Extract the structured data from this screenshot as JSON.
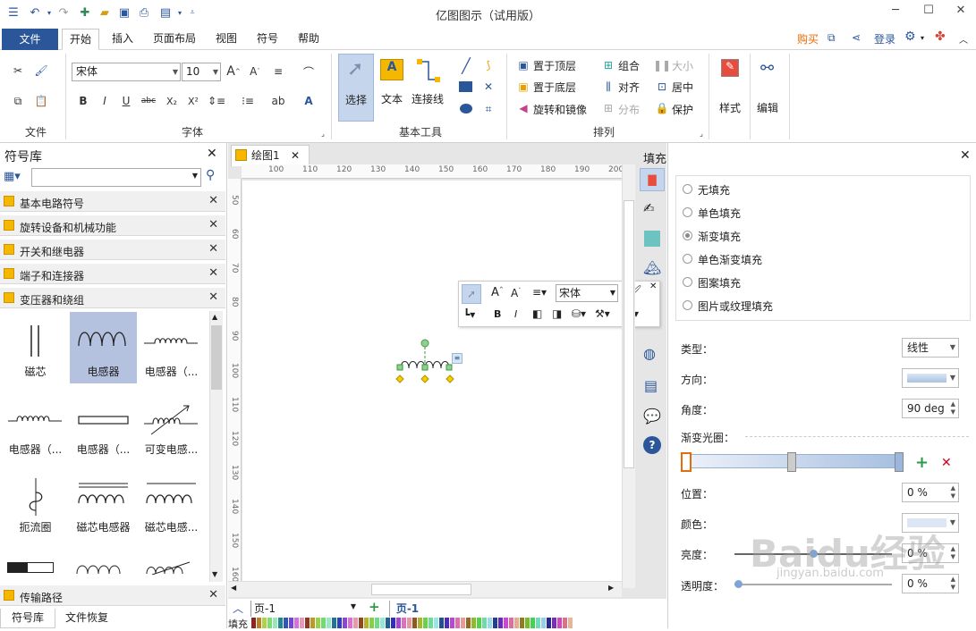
{
  "app_title": "亿图图示（试用版）",
  "menu": {
    "file": "文件",
    "tabs": [
      "开始",
      "插入",
      "页面布局",
      "视图",
      "符号",
      "帮助"
    ],
    "buy": "购买",
    "login": "登录"
  },
  "ribbon": {
    "group_file": "文件",
    "font_name": "宋体",
    "font_size": "10",
    "group_font": "字体",
    "select": "选择",
    "text": "文本",
    "connector": "连接线",
    "group_basic_tools": "基本工具",
    "bring_front": "置于顶层",
    "send_back": "置于底层",
    "rotate_mirror": "旋转和镜像",
    "group": "组合",
    "align": "对齐",
    "distribute": "分布",
    "size": "大小",
    "center": "居中",
    "protect": "保护",
    "group_arrange": "排列",
    "style": "样式",
    "edit": "编辑"
  },
  "library": {
    "title": "符号库",
    "search_placeholder": "",
    "categories": [
      "基本电路符号",
      "旋转设备和机械功能",
      "开关和继电器",
      "端子和连接器",
      "变压器和绕组"
    ],
    "shapes": [
      "磁芯",
      "电感器",
      "电感器（...",
      "电感器（...",
      "电感器（...",
      "可变电感...",
      "扼流圈",
      "磁芯电感器",
      "磁芯电感..."
    ],
    "bottom_category": "传输路径",
    "bottom_tabs": [
      "符号库",
      "文件恢复"
    ]
  },
  "canvas": {
    "doc_tab": "绘图1",
    "hruler_ticks": [
      "100",
      "110",
      "120",
      "130",
      "140",
      "150",
      "160",
      "170",
      "180",
      "190",
      "200"
    ],
    "vruler_ticks": [
      "50",
      "60",
      "70",
      "80",
      "90",
      "100",
      "110",
      "120",
      "130",
      "140",
      "150",
      "160"
    ],
    "float_font": "宋体",
    "page_selector": "页-1",
    "page_tab": "页-1",
    "fill_label": "填充"
  },
  "fill_panel": {
    "title": "填充",
    "options": [
      "无填充",
      "单色填充",
      "渐变填充",
      "单色渐变填充",
      "图案填充",
      "图片或纹理填充"
    ],
    "selected_option": "渐变填充",
    "type_label": "类型：",
    "type_value": "线性",
    "direction_label": "方向：",
    "angle_label": "角度：",
    "angle_value": "90 deg",
    "stops_label": "渐变光圈：",
    "position_label": "位置：",
    "position_value": "0 %",
    "color_label": "颜色：",
    "brightness_label": "亮度：",
    "brightness_value": "0 %",
    "transparency_label": "透明度：",
    "transparency_value": "0 %"
  },
  "watermark": {
    "text": "Baidu经验",
    "url": "jingyan.baidu.com"
  },
  "colors": {
    "accent": "#2b579a",
    "selected_shape_bg": "#b4c2e0",
    "buy": "#e46c0a"
  }
}
